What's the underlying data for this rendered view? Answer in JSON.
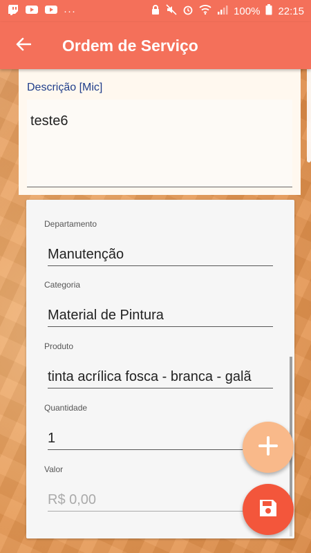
{
  "status_bar": {
    "battery": "100%",
    "time": "22:15",
    "more": "···"
  },
  "app_bar": {
    "title": "Ordem de Serviço"
  },
  "description": {
    "label": "Descrição [Mic]",
    "value": "teste6"
  },
  "form": {
    "department": {
      "label": "Departamento",
      "value": "Manutenção"
    },
    "category": {
      "label": "Categoria",
      "value": "Material de Pintura"
    },
    "product": {
      "label": "Produto",
      "value": "tinta acrílica fosca - branca - galã"
    },
    "quantity": {
      "label": "Quantidade",
      "value": "1"
    },
    "price": {
      "label": "Valor",
      "placeholder": "R$ 0,00"
    }
  },
  "colors": {
    "primary": "#f4705a",
    "fab_add": "#f9b98a",
    "fab_save": "#f3563b",
    "description_label": "#1f3d8a"
  }
}
